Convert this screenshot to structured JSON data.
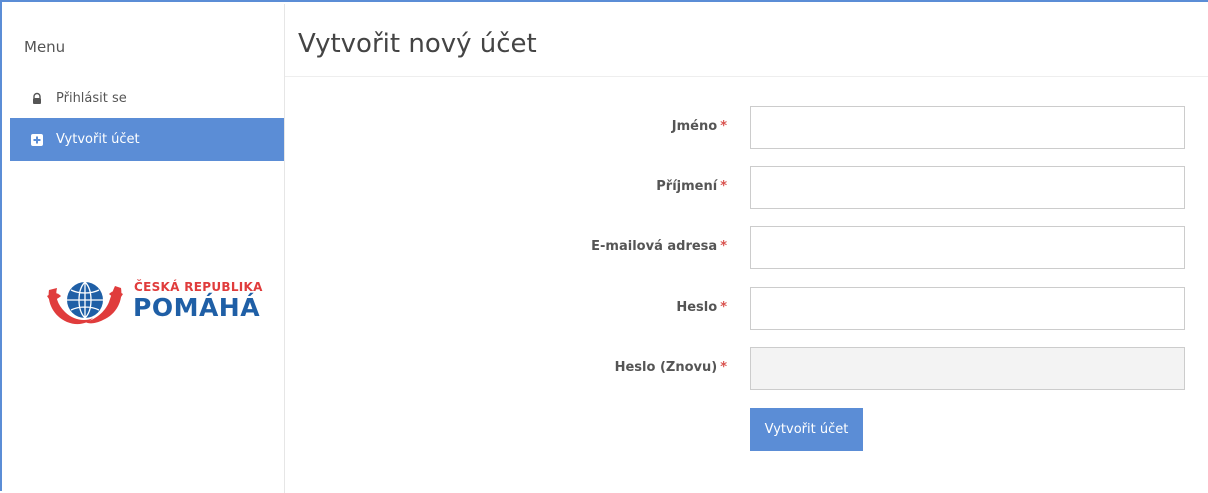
{
  "sidebar": {
    "menu_title": "Menu",
    "items": [
      {
        "label": "Přihlásit se",
        "icon": "lock-icon"
      },
      {
        "label": "Vytvořit účet",
        "icon": "plus-square-icon",
        "active": true
      }
    ],
    "logo": {
      "line1": "ČESKÁ REPUBLIKA",
      "line2": "POMÁHÁ"
    }
  },
  "main": {
    "title": "Vytvořit nový účet",
    "fields": [
      {
        "label": "Jméno",
        "required": "*",
        "value": ""
      },
      {
        "label": "Příjmení",
        "required": "*",
        "value": ""
      },
      {
        "label": "E-mailová adresa",
        "required": "*",
        "value": ""
      },
      {
        "label": "Heslo",
        "required": "*",
        "value": ""
      },
      {
        "label": "Heslo (Znovu)",
        "required": "*",
        "value": ""
      }
    ],
    "submit_label": "Vytvořit účet"
  },
  "colors": {
    "accent": "#5b8dd6",
    "required": "#d9534f",
    "logo_red": "#e03c3c",
    "logo_blue": "#1f5fa6"
  }
}
